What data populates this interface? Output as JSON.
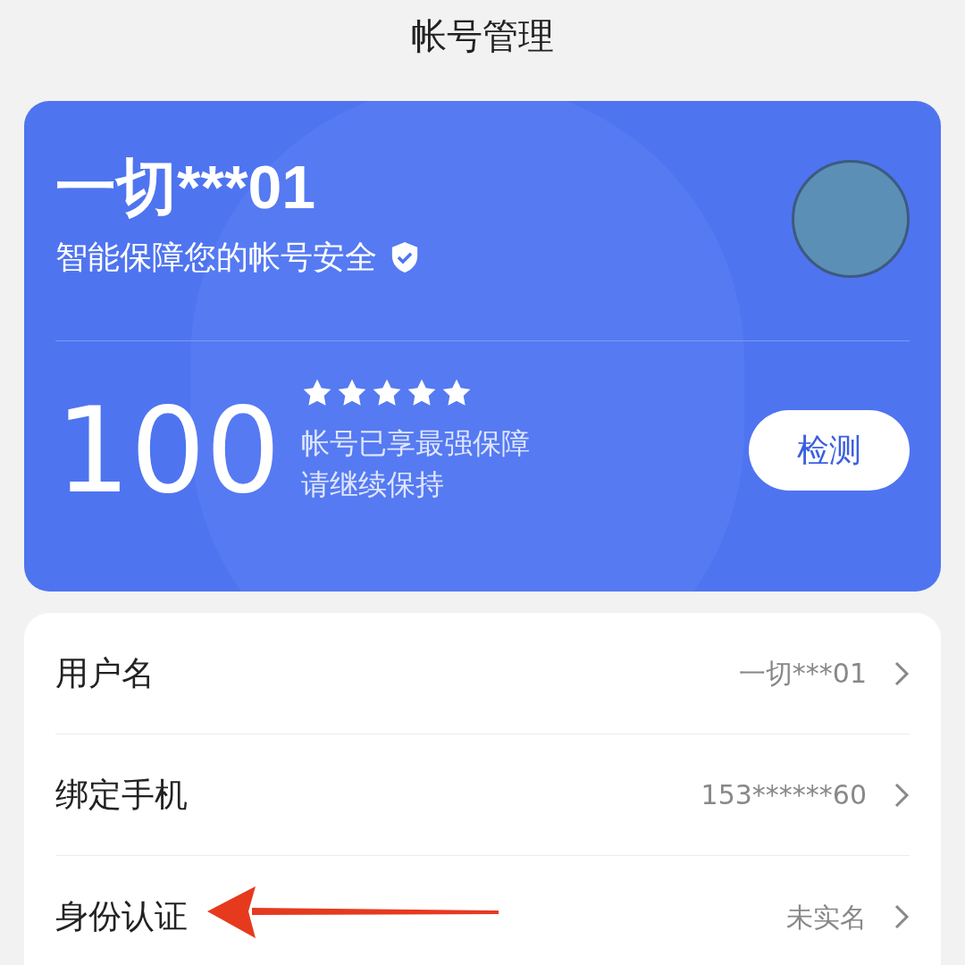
{
  "header": {
    "title": "帐号管理"
  },
  "account_card": {
    "name": "一切***01",
    "subtitle": "智能保障您的帐号安全",
    "score": "100",
    "stars": 5,
    "status_lines": [
      "帐号已享最强保障",
      "请继续保持"
    ],
    "check_button": "检测"
  },
  "settings": [
    {
      "label": "用户名",
      "value": "一切***01"
    },
    {
      "label": "绑定手机",
      "value": "153******60"
    },
    {
      "label": "身份认证",
      "value": "未实名"
    }
  ],
  "annotation": {
    "kind": "arrow"
  }
}
